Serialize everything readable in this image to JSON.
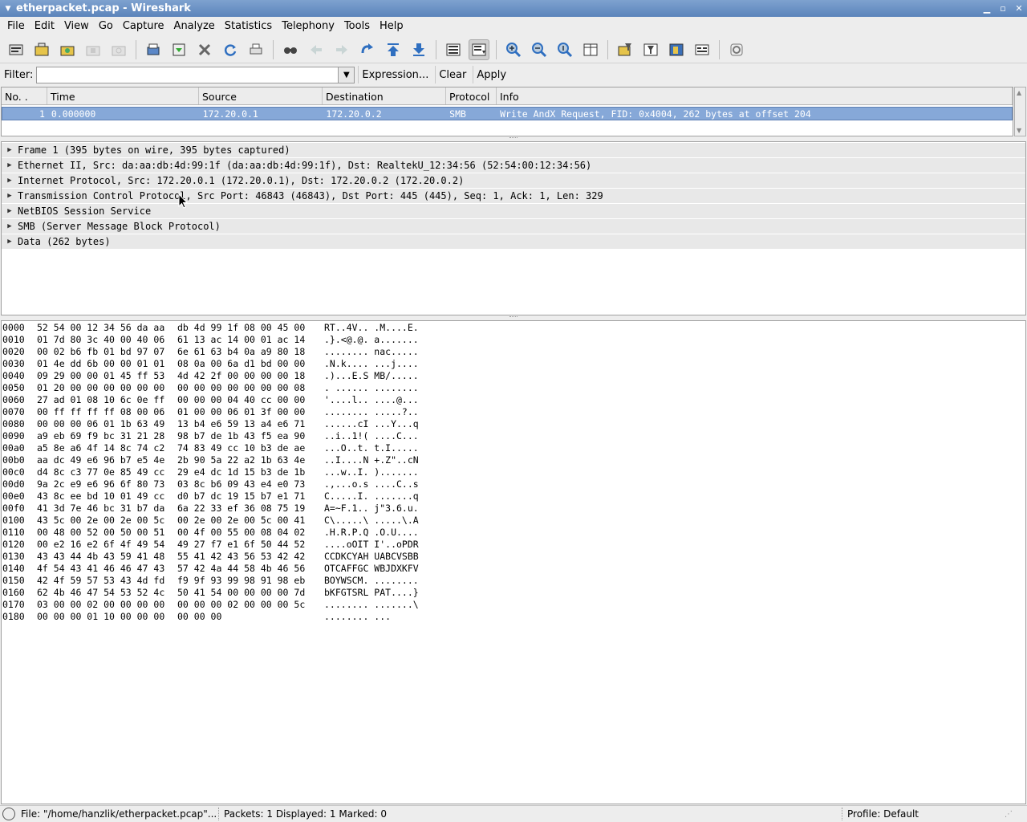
{
  "window": {
    "title": "etherpacket.pcap - Wireshark",
    "minimize_label": "▁",
    "maximize_label": "▫",
    "close_label": "✕"
  },
  "menu": [
    {
      "label": "File"
    },
    {
      "label": "Edit"
    },
    {
      "label": "View"
    },
    {
      "label": "Go"
    },
    {
      "label": "Capture"
    },
    {
      "label": "Analyze"
    },
    {
      "label": "Statistics"
    },
    {
      "label": "Telephony"
    },
    {
      "label": "Tools"
    },
    {
      "label": "Help"
    }
  ],
  "filter": {
    "label": "Filter:",
    "value": "",
    "expression_label": "Expression...",
    "clear_label": "Clear",
    "apply_label": "Apply"
  },
  "packet_list": {
    "columns": [
      "No. .",
      "Time",
      "Source",
      "Destination",
      "Protocol",
      "Info"
    ],
    "rows": [
      {
        "no": "1",
        "time": "0.000000",
        "source": "172.20.0.1",
        "destination": "172.20.0.2",
        "protocol": "SMB",
        "info": "Write AndX Request, FID: 0x4004, 262 bytes at offset 204"
      }
    ]
  },
  "details": [
    "Frame 1 (395 bytes on wire, 395 bytes captured)",
    "Ethernet II, Src: da:aa:db:4d:99:1f (da:aa:db:4d:99:1f), Dst: RealtekU_12:34:56 (52:54:00:12:34:56)",
    "Internet Protocol, Src: 172.20.0.1 (172.20.0.1), Dst: 172.20.0.2 (172.20.0.2)",
    "Transmission Control Protocol, Src Port: 46843 (46843), Dst Port: 445 (445), Seq: 1, Ack: 1, Len: 329",
    "NetBIOS Session Service",
    "SMB (Server Message Block Protocol)",
    "Data (262 bytes)"
  ],
  "bytes": [
    {
      "off": "0000",
      "h1": "52 54 00 12 34 56 da aa",
      "h2": "db 4d 99 1f 08 00 45 00",
      "asc": "RT..4V.. .M....E."
    },
    {
      "off": "0010",
      "h1": "01 7d 80 3c 40 00 40 06",
      "h2": "61 13 ac 14 00 01 ac 14",
      "asc": ".}.<@.@. a......."
    },
    {
      "off": "0020",
      "h1": "00 02 b6 fb 01 bd 97 07",
      "h2": "6e 61 63 b4 0a a9 80 18",
      "asc": "........ nac....."
    },
    {
      "off": "0030",
      "h1": "01 4e dd 6b 00 00 01 01",
      "h2": "08 0a 00 6a d1 bd 00 00",
      "asc": ".N.k.... ...j...."
    },
    {
      "off": "0040",
      "h1": "09 29 00 00 01 45 ff 53",
      "h2": "4d 42 2f 00 00 00 00 18",
      "asc": ".)...E.S MB/....."
    },
    {
      "off": "0050",
      "h1": "01 20 00 00 00 00 00 00",
      "h2": "00 00 00 00 00 00 00 08",
      "asc": ". ...... ........"
    },
    {
      "off": "0060",
      "h1": "27 ad 01 08 10 6c 0e ff",
      "h2": "00 00 00 04 40 cc 00 00",
      "asc": "'....l.. ....@..."
    },
    {
      "off": "0070",
      "h1": "00 ff ff ff ff 08 00 06",
      "h2": "01 00 00 06 01 3f 00 00",
      "asc": "........ .....?.."
    },
    {
      "off": "0080",
      "h1": "00 00 00 06 01 1b 63 49",
      "h2": "13 b4 e6 59 13 a4 e6 71",
      "asc": "......cI ...Y...q"
    },
    {
      "off": "0090",
      "h1": "a9 eb 69 f9 bc 31 21 28",
      "h2": "98 b7 de 1b 43 f5 ea 90",
      "asc": "..i..1!( ....C..."
    },
    {
      "off": "00a0",
      "h1": "a5 8e a6 4f 14 8c 74 c2",
      "h2": "74 83 49 cc 10 b3 de ae",
      "asc": "...O..t. t.I....."
    },
    {
      "off": "00b0",
      "h1": "aa dc 49 e6 96 b7 e5 4e",
      "h2": "2b 90 5a 22 a2 1b 63 4e",
      "asc": "..I....N +.Z\"..cN"
    },
    {
      "off": "00c0",
      "h1": "d4 8c c3 77 0e 85 49 cc",
      "h2": "29 e4 dc 1d 15 b3 de 1b",
      "asc": "...w..I. )......."
    },
    {
      "off": "00d0",
      "h1": "9a 2c e9 e6 96 6f 80 73",
      "h2": "03 8c b6 09 43 e4 e0 73",
      "asc": ".,...o.s ....C..s"
    },
    {
      "off": "00e0",
      "h1": "43 8c ee bd 10 01 49 cc",
      "h2": "d0 b7 dc 19 15 b7 e1 71",
      "asc": "C.....I. .......q"
    },
    {
      "off": "00f0",
      "h1": "41 3d 7e 46 bc 31 b7 da",
      "h2": "6a 22 33 ef 36 08 75 19",
      "asc": "A=~F.1.. j\"3.6.u."
    },
    {
      "off": "0100",
      "h1": "43 5c 00 2e 00 2e 00 5c",
      "h2": "00 2e 00 2e 00 5c 00 41",
      "asc": "C\\.....\\ .....\\.A"
    },
    {
      "off": "0110",
      "h1": "00 48 00 52 00 50 00 51",
      "h2": "00 4f 00 55 00 08 04 02",
      "asc": ".H.R.P.Q .O.U...."
    },
    {
      "off": "0120",
      "h1": "00 e2 16 e2 6f 4f 49 54",
      "h2": "49 27 f7 e1 6f 50 44 52",
      "asc": "....oOIT I'..oPDR"
    },
    {
      "off": "0130",
      "h1": "43 43 44 4b 43 59 41 48",
      "h2": "55 41 42 43 56 53 42 42",
      "asc": "CCDKCYAH UABCVSBB"
    },
    {
      "off": "0140",
      "h1": "4f 54 43 41 46 46 47 43",
      "h2": "57 42 4a 44 58 4b 46 56",
      "asc": "OTCAFFGC WBJDXKFV"
    },
    {
      "off": "0150",
      "h1": "42 4f 59 57 53 43 4d fd",
      "h2": "f9 9f 93 99 98 91 98 eb",
      "asc": "BOYWSCM. ........"
    },
    {
      "off": "0160",
      "h1": "62 4b 46 47 54 53 52 4c",
      "h2": "50 41 54 00 00 00 00 7d",
      "asc": "bKFGTSRL PAT....}"
    },
    {
      "off": "0170",
      "h1": "03 00 00 02 00 00 00 00",
      "h2": "00 00 00 02 00 00 00 5c",
      "asc": "........ .......\\"
    },
    {
      "off": "0180",
      "h1": "00 00 00 01 10 00 00 00",
      "h2": "00 00 00",
      "asc": "........ ..."
    }
  ],
  "status": {
    "file": "File: \"/home/hanzlik/etherpacket.pcap\"...",
    "packets": "Packets: 1 Displayed: 1 Marked: 0",
    "profile": "Profile: Default"
  },
  "toolbar_icons": [
    "interface-list-icon",
    "capture-options-icon",
    "start-capture-icon",
    "stop-capture-icon",
    "restart-capture-icon",
    "open-file-icon",
    "save-file-icon",
    "close-file-icon",
    "reload-icon",
    "print-icon",
    "find-packet-icon",
    "go-back-icon",
    "go-forward-icon",
    "go-to-packet-icon",
    "go-first-icon",
    "go-last-icon",
    "colorize-icon",
    "auto-scroll-icon",
    "zoom-in-icon",
    "zoom-out-icon",
    "normal-size-icon",
    "resize-columns-icon",
    "capture-filters-icon",
    "display-filters-icon",
    "coloring-rules-icon",
    "preferences-icon",
    "help-icon"
  ],
  "colors": {
    "selection": "#86a8d8",
    "titlebar": "#6b93c6"
  }
}
